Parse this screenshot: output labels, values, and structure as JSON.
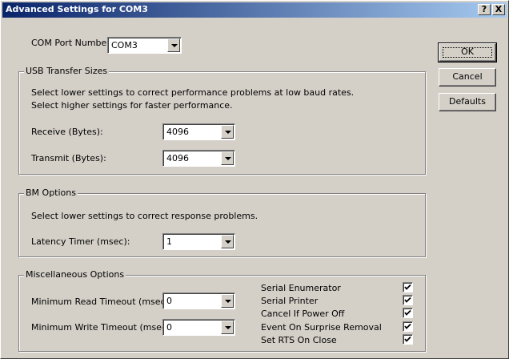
{
  "window": {
    "title": "Advanced Settings for COM3",
    "help_button": "?",
    "close_button": "X"
  },
  "com_port": {
    "label": "COM Port Number:",
    "value": "COM3"
  },
  "usb_transfer": {
    "title": "USB Transfer Sizes",
    "desc1": "Select lower settings to correct performance problems at low baud rates.",
    "desc2": "Select higher settings for faster performance.",
    "receive_label": "Receive (Bytes):",
    "receive_value": "4096",
    "transmit_label": "Transmit (Bytes):",
    "transmit_value": "4096"
  },
  "bm_options": {
    "title": "BM Options",
    "desc": "Select lower settings to correct response problems.",
    "latency_label": "Latency Timer (msec):",
    "latency_value": "1"
  },
  "misc": {
    "title": "Miscellaneous Options",
    "read_timeout_label": "Minimum Read Timeout (msec):",
    "read_timeout_value": "0",
    "write_timeout_label": "Minimum Write Timeout (msec):",
    "write_timeout_value": "0",
    "checkboxes": [
      {
        "label": "Serial Enumerator",
        "checked": true
      },
      {
        "label": "Serial Printer",
        "checked": true
      },
      {
        "label": "Cancel If Power Off",
        "checked": true
      },
      {
        "label": "Event On Surprise Removal",
        "checked": true
      },
      {
        "label": "Set RTS On Close",
        "checked": true
      }
    ]
  },
  "buttons": {
    "ok": "OK",
    "cancel": "Cancel",
    "defaults": "Defaults"
  }
}
